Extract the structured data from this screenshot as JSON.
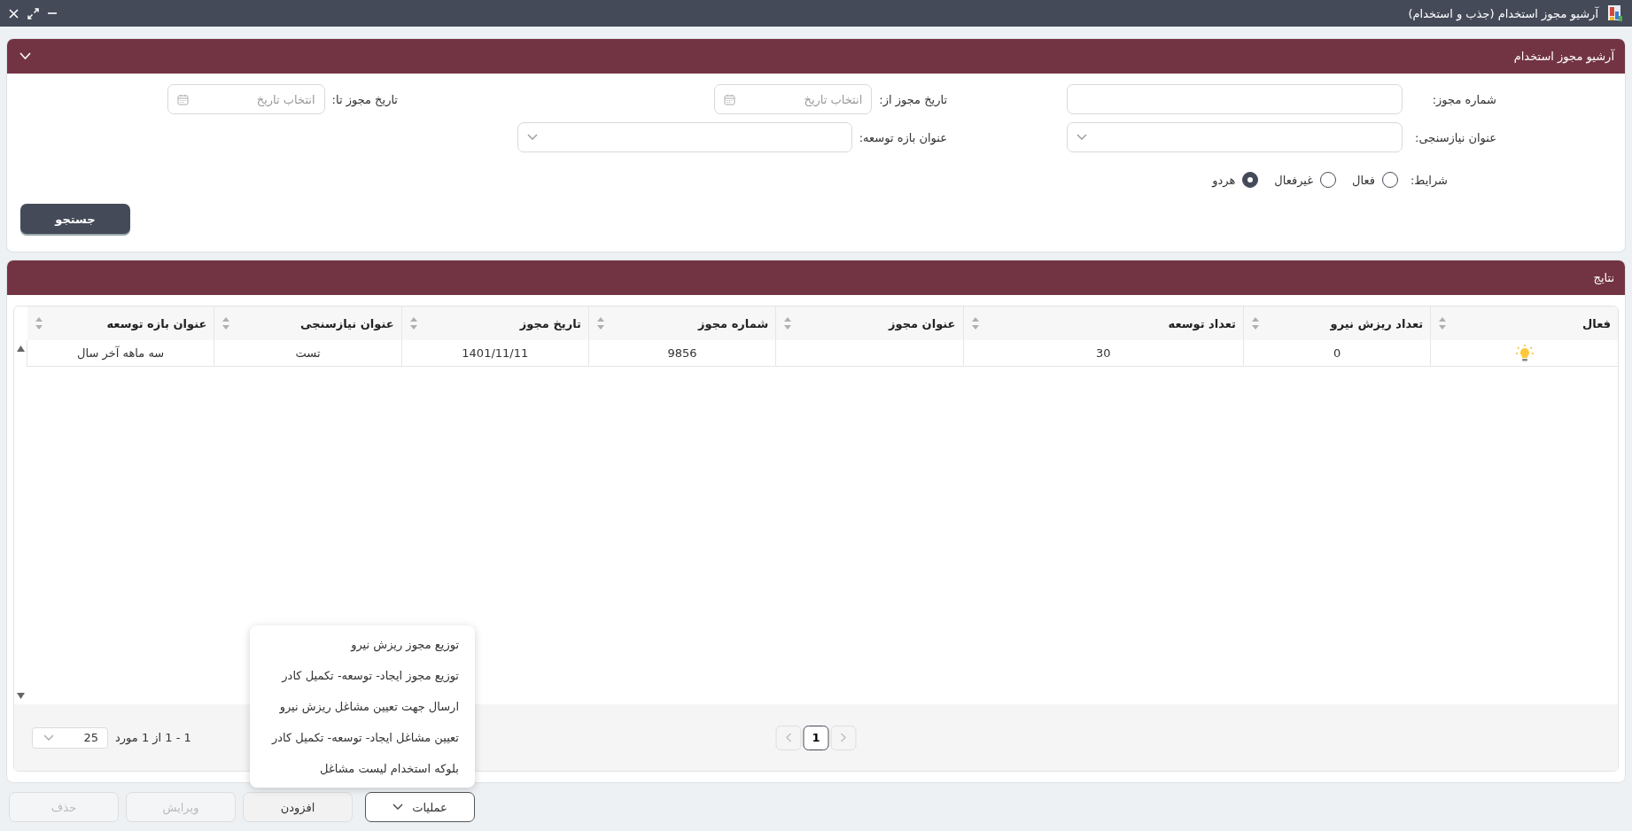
{
  "window": {
    "title": "آرشیو مجوز استخدام (جذب و استخدام)"
  },
  "search_panel": {
    "title": "آرشیو مجوز استخدام",
    "expanded": true,
    "field_rows": [
      [
        {
          "kind": "text",
          "label": "شماره مجوز:"
        },
        {
          "kind": "date",
          "label": "تاریخ مجوز از:",
          "placeholder": "انتخاب تاریخ"
        },
        {
          "kind": "date",
          "label": "تاریخ مجوز تا:",
          "placeholder": "انتخاب تاریخ"
        }
      ],
      [
        {
          "kind": "select",
          "label": "عنوان نیازسنجی:"
        },
        {
          "kind": "select",
          "label": "عنوان بازه توسعه:"
        }
      ]
    ],
    "conditions": {
      "label": "شرایط:",
      "options": [
        {
          "label": "فعال",
          "selected": false
        },
        {
          "label": "غیرفعال",
          "selected": false
        },
        {
          "label": "هردو",
          "selected": true
        }
      ]
    },
    "search_button": "جستجو"
  },
  "results_panel": {
    "title": "نتایج",
    "columns": [
      "فعال",
      "تعداد ریزش نیرو",
      "تعداد توسعه",
      "عنوان مجوز",
      "شماره مجوز",
      "تاریخ مجوز",
      "عنوان نیازسنجی",
      "عنوان بازه توسعه"
    ],
    "rows": [
      {
        "active": true,
        "cells": [
          "",
          "0",
          "30",
          "",
          "9856",
          "1401/11/11",
          "تست",
          "سه ماهه آخر سال"
        ]
      }
    ],
    "pagination": {
      "summary": "1 - 1 از 1 مورد",
      "page_size": "25",
      "pages": [
        {
          "label": "1",
          "selected": true
        }
      ]
    }
  },
  "actions": {
    "buttons": [
      {
        "kind": "menu",
        "label": "عملیات",
        "disabled": false
      },
      {
        "kind": "plain",
        "label": "افزودن",
        "disabled": false
      },
      {
        "kind": "plain",
        "label": "ویرایش",
        "disabled": true
      },
      {
        "kind": "plain",
        "label": "حذف",
        "disabled": true
      }
    ],
    "menu": {
      "expanded": true,
      "items": [
        "توزیع مجوز ریزش نیرو",
        "توزیع مجوز ایجاد- توسعه- تکمیل کادر",
        "ارسال جهت تعیین مشاغل ریزش نیرو",
        "تعیین مشاغل ایجاد- توسعه- تکمیل کادر",
        "بلوکه استخدام لیست مشاغل"
      ]
    }
  }
}
